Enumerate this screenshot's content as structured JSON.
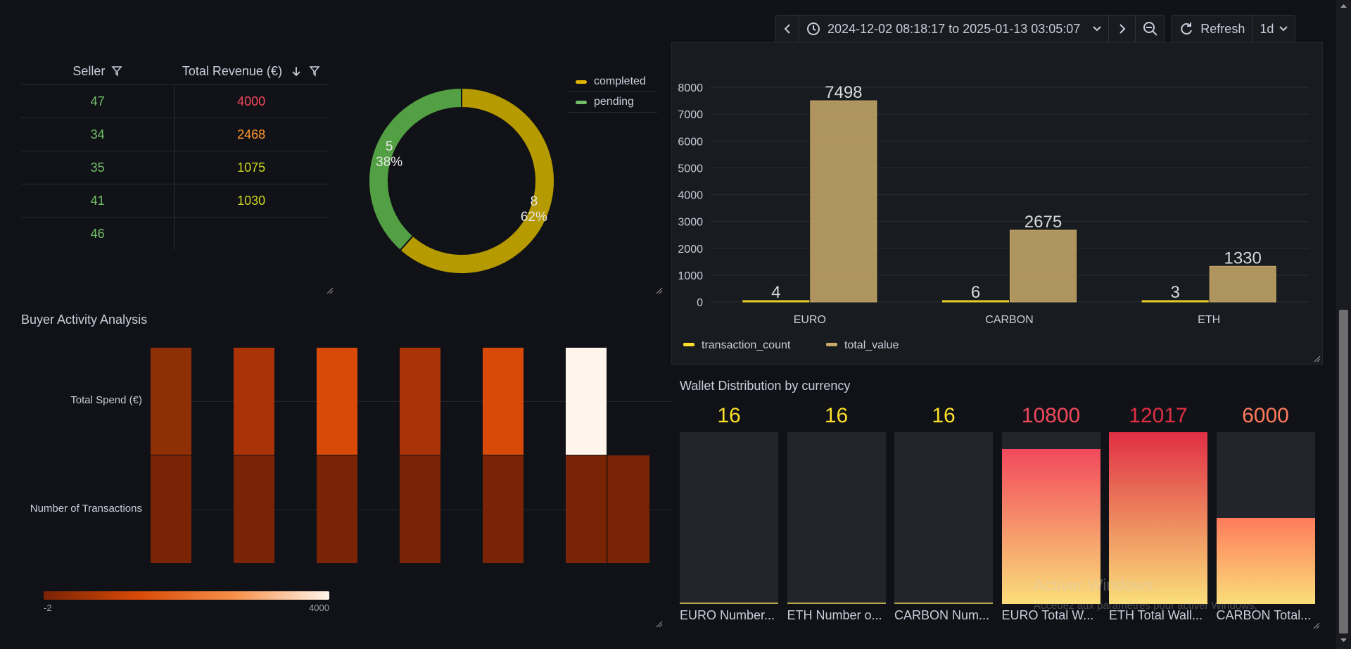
{
  "toolbar": {
    "time_range": "2024-12-02 08:18:17 to 2025-01-13 03:05:07",
    "refresh_label": "Refresh",
    "interval": "1d"
  },
  "seller_table": {
    "columns": [
      "Seller",
      "Total Revenue (€)"
    ],
    "rows": [
      {
        "seller": "47",
        "revenue": "4000",
        "color": "#f2495c"
      },
      {
        "seller": "34",
        "revenue": "2468",
        "color": "#ff9830"
      },
      {
        "seller": "35",
        "revenue": "1075",
        "color": "#cbd61c"
      },
      {
        "seller": "41",
        "revenue": "1030",
        "color": "#cbd61c"
      },
      {
        "seller": "46",
        "revenue": "",
        "color": "#73bf69"
      }
    ]
  },
  "donut": {
    "legend": [
      {
        "name": "completed",
        "color": "#e0b400"
      },
      {
        "name": "pending",
        "color": "#73bf69"
      }
    ],
    "slices": [
      {
        "name": "completed",
        "value": 8,
        "label_value": "8",
        "label_pct": "62%",
        "color": "#b59a00"
      },
      {
        "name": "pending",
        "value": 5,
        "label_value": "5",
        "label_pct": "38%",
        "color": "#52a043"
      }
    ]
  },
  "buyer_heatmap": {
    "title": "Buyer Activity Analysis",
    "rows": [
      "Total Spend (€)",
      "Number of Transactions"
    ],
    "scale_min": "-2",
    "scale_max": "4000"
  },
  "currency_chart": {
    "chart_data": {
      "type": "bar",
      "categories": [
        "EURO",
        "CARBON",
        "ETH"
      ],
      "series": [
        {
          "name": "transaction_count",
          "values": [
            4,
            6,
            3
          ],
          "color": "#fade2a"
        },
        {
          "name": "total_value",
          "values": [
            7498,
            2675,
            1330
          ],
          "color": "#c9a96a"
        }
      ],
      "ylim": [
        0,
        8000
      ],
      "yticks": [
        "0",
        "1000",
        "2000",
        "3000",
        "4000",
        "5000",
        "6000",
        "7000",
        "8000"
      ],
      "grid": true,
      "legend_placement": "bottom-left"
    }
  },
  "wallet": {
    "title": "Wallet Distribution by currency",
    "items": [
      {
        "value": "16",
        "label": "EURO Number...",
        "fraction": 0.01,
        "color": "#fade2a"
      },
      {
        "value": "16",
        "label": "ETH Number o...",
        "fraction": 0.01,
        "color": "#fade2a"
      },
      {
        "value": "16",
        "label": "CARBON Num...",
        "fraction": 0.01,
        "color": "#fade2a"
      },
      {
        "value": "10800",
        "label": "EURO Total W...",
        "fraction": 0.9,
        "color": "#f2495c"
      },
      {
        "value": "12017",
        "label": "ETH Total Wall...",
        "fraction": 1.0,
        "color": "#e02f44"
      },
      {
        "value": "6000",
        "label": "CARBON Total...",
        "fraction": 0.5,
        "color": "#ff7b5c"
      }
    ]
  },
  "watermark": {
    "title": "Activer Windows",
    "subtitle": "Accédez aux paramètres pour activer Windows."
  }
}
